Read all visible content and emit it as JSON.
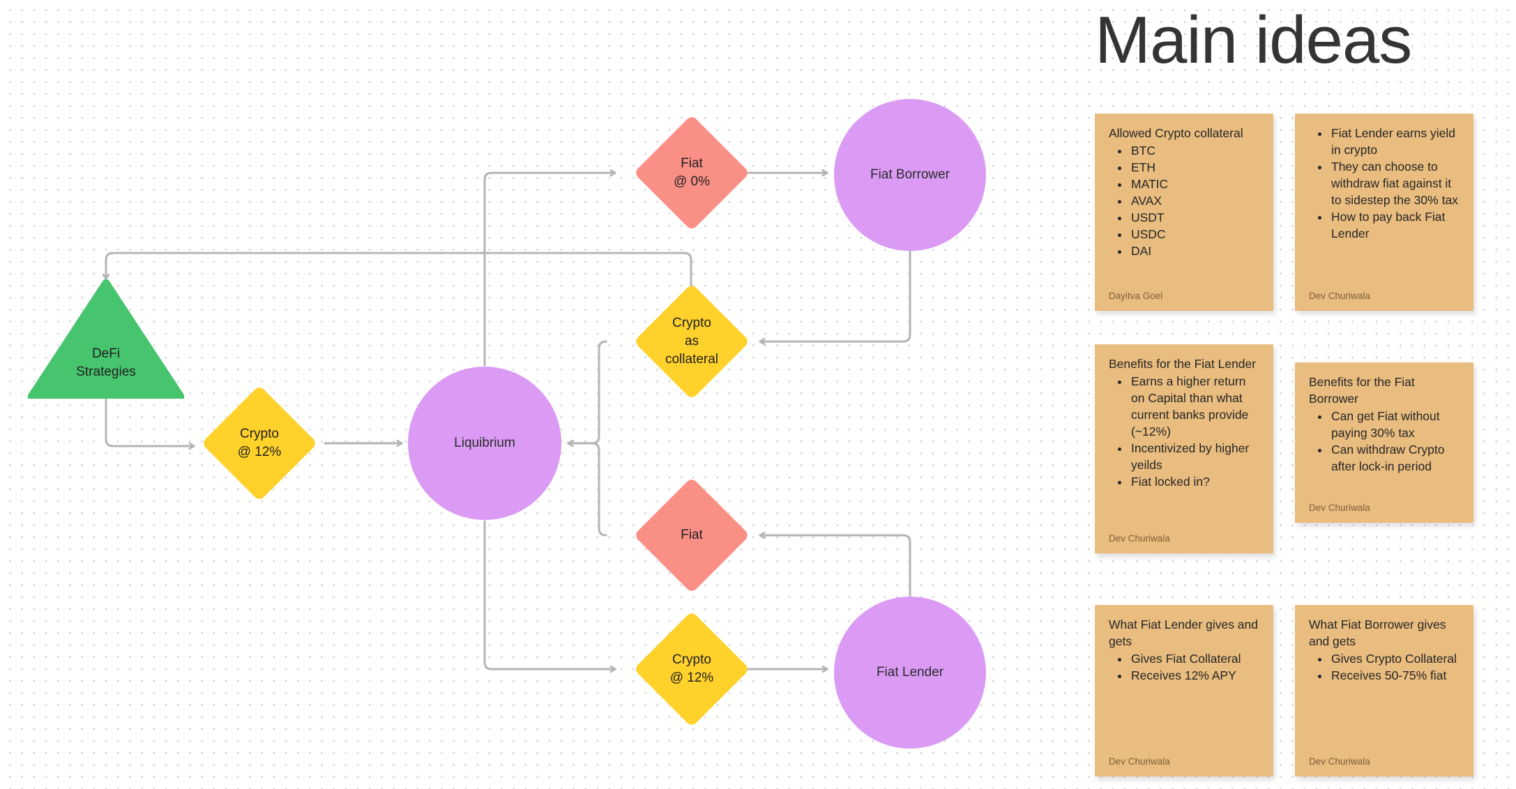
{
  "board": {
    "background_color": "#ffffff",
    "dot_color": "#d4d4d4",
    "connector_color": "#b4b4b4"
  },
  "palette": {
    "green": "#47C46E",
    "yellow": "#FFD12B",
    "salmon": "#FA8F85",
    "purple": "#DB9BF5",
    "sticky": "#E9BC7F",
    "text": "#1f1f1f",
    "author": "#7d6038"
  },
  "diagram": {
    "nodes": [
      {
        "id": "defi-strategies",
        "shape": "triangle",
        "label": "DeFi\nStrategies",
        "color": "#47C46E"
      },
      {
        "id": "crypto-12-left",
        "shape": "diamond",
        "label": "Crypto\n@ 12%",
        "color": "#FFD12B"
      },
      {
        "id": "liquibrium",
        "shape": "circle",
        "label": "Liquibrium",
        "color": "#DB9BF5"
      },
      {
        "id": "fiat-0",
        "shape": "diamond",
        "label": "Fiat\n@ 0%",
        "color": "#FA8F85"
      },
      {
        "id": "fiat-borrower",
        "shape": "circle",
        "label": "Fiat Borrower",
        "color": "#DB9BF5"
      },
      {
        "id": "crypto-collateral",
        "shape": "diamond",
        "label": "Crypto\nas\ncollateral",
        "color": "#FFD12B"
      },
      {
        "id": "fiat",
        "shape": "diamond",
        "label": "Fiat",
        "color": "#FA8F85"
      },
      {
        "id": "crypto-12-bottom",
        "shape": "diamond",
        "label": "Crypto\n@ 12%",
        "color": "#FFD12B"
      },
      {
        "id": "fiat-lender",
        "shape": "circle",
        "label": "Fiat Lender",
        "color": "#DB9BF5"
      }
    ],
    "edges": [
      {
        "from": "defi-strategies",
        "to": "crypto-12-left"
      },
      {
        "from": "crypto-12-left",
        "to": "liquibrium"
      },
      {
        "from": "liquibrium",
        "to": "fiat-0"
      },
      {
        "from": "fiat-0",
        "to": "fiat-borrower"
      },
      {
        "from": "fiat-borrower",
        "to": "crypto-collateral"
      },
      {
        "from": "crypto-collateral",
        "to": "defi-strategies"
      },
      {
        "from": "crypto-collateral",
        "to": "liquibrium"
      },
      {
        "from": "liquibrium",
        "to": "crypto-12-bottom"
      },
      {
        "from": "crypto-12-bottom",
        "to": "fiat-lender"
      },
      {
        "from": "fiat-lender",
        "to": "fiat"
      },
      {
        "from": "fiat",
        "to": "liquibrium"
      }
    ]
  },
  "panel": {
    "title": "Main ideas",
    "notes": [
      {
        "id": "allowed-crypto-collateral",
        "title": "Allowed Crypto collateral",
        "bullets": [
          "BTC",
          "ETH",
          "MATIC",
          "AVAX",
          "USDT",
          "USDC",
          "DAI"
        ],
        "author": "Dayitva Goel"
      },
      {
        "id": "fiat-lender-yield",
        "title": "",
        "bullets": [
          "Fiat Lender earns yield in crypto",
          "They can choose to withdraw fiat against it to sidestep the 30% tax",
          "How to pay back Fiat Lender"
        ],
        "author": "Dev Churiwala"
      },
      {
        "id": "benefits-fiat-lender",
        "title": "Benefits for the Fiat Lender",
        "bullets": [
          "Earns a higher return on Capital than what current banks provide (~12%)",
          "Incentivized by higher yeilds",
          "Fiat locked in?"
        ],
        "author": "Dev Churiwala"
      },
      {
        "id": "benefits-fiat-borrower",
        "title": "Benefits for the Fiat Borrower",
        "bullets": [
          "Can get Fiat without paying 30% tax",
          "Can withdraw Crypto after lock-in period"
        ],
        "author": "Dev Churiwala"
      },
      {
        "id": "fiat-lender-gives-gets",
        "title": "What Fiat Lender gives and gets",
        "bullets": [
          "Gives Fiat Collateral",
          "Receives 12% APY"
        ],
        "author": "Dev Churiwala"
      },
      {
        "id": "fiat-borrower-gives-gets",
        "title": "What Fiat Borrower gives and gets",
        "bullets": [
          "Gives Crypto Collateral",
          "Receives 50-75% fiat"
        ],
        "author": "Dev Churiwala"
      }
    ]
  }
}
